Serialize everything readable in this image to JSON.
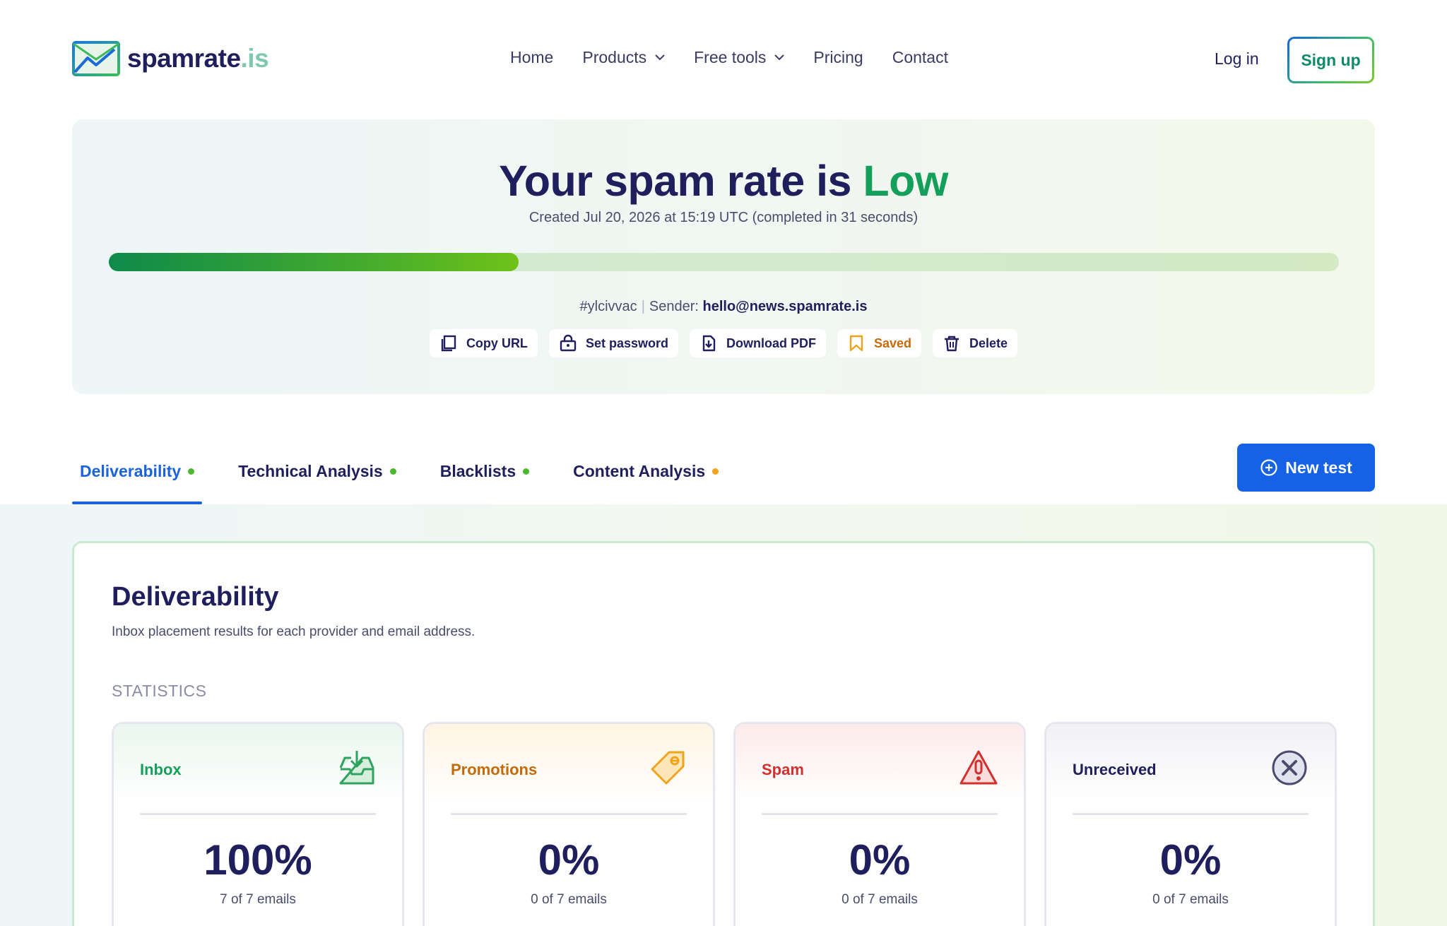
{
  "header": {
    "logo_text": "spamrate",
    "logo_ext": ".is",
    "nav": [
      {
        "label": "Home",
        "dropdown": false
      },
      {
        "label": "Products",
        "dropdown": true
      },
      {
        "label": "Free tools",
        "dropdown": true
      },
      {
        "label": "Pricing",
        "dropdown": false
      },
      {
        "label": "Contact",
        "dropdown": false
      }
    ],
    "login_label": "Log in",
    "signup_label": "Sign up"
  },
  "hero": {
    "title_prefix": "Your spam rate is",
    "title_level": "Low",
    "created": "Created Jul 20, 2026 at 15:19 UTC (completed in 31 seconds)",
    "progress_fraction": 0.333,
    "test_id": "#ylcivvac",
    "sender_label": "Sender:",
    "sender_value": "hello@news.spamrate.is",
    "actions": {
      "copy_url": "Copy URL",
      "set_password": "Set password",
      "download_pdf": "Download PDF",
      "saved": "Saved",
      "delete": "Delete"
    }
  },
  "tabs": [
    {
      "label": "Deliverability",
      "status_color": "#4cb82e",
      "active": true
    },
    {
      "label": "Technical Analysis",
      "status_color": "#4cb82e",
      "active": false
    },
    {
      "label": "Blacklists",
      "status_color": "#4cb82e",
      "active": false
    },
    {
      "label": "Content Analysis",
      "status_color": "#f2a31c",
      "active": false
    }
  ],
  "new_test_label": "New test",
  "deliverability": {
    "title": "Deliverability",
    "subtitle": "Inbox placement results for each provider and email address.",
    "stats_label": "STATISTICS",
    "cards": [
      {
        "name": "Inbox",
        "value": "100%",
        "count": "7 of 7 emails",
        "color": "#14a05a",
        "icon": "inbox-icon"
      },
      {
        "name": "Promotions",
        "value": "0%",
        "count": "0 of 7 emails",
        "color": "#c46a0a",
        "icon": "tag-icon"
      },
      {
        "name": "Spam",
        "value": "0%",
        "count": "0 of 7 emails",
        "color": "#d0312d",
        "icon": "warning-icon"
      },
      {
        "name": "Unreceived",
        "value": "0%",
        "count": "0 of 7 emails",
        "color": "#1e1f5c",
        "icon": "x-circle-icon"
      }
    ]
  },
  "colors": {
    "brand_navy": "#1e1f5c",
    "accent_blue": "#1662e6",
    "low_green": "#14a05a"
  }
}
